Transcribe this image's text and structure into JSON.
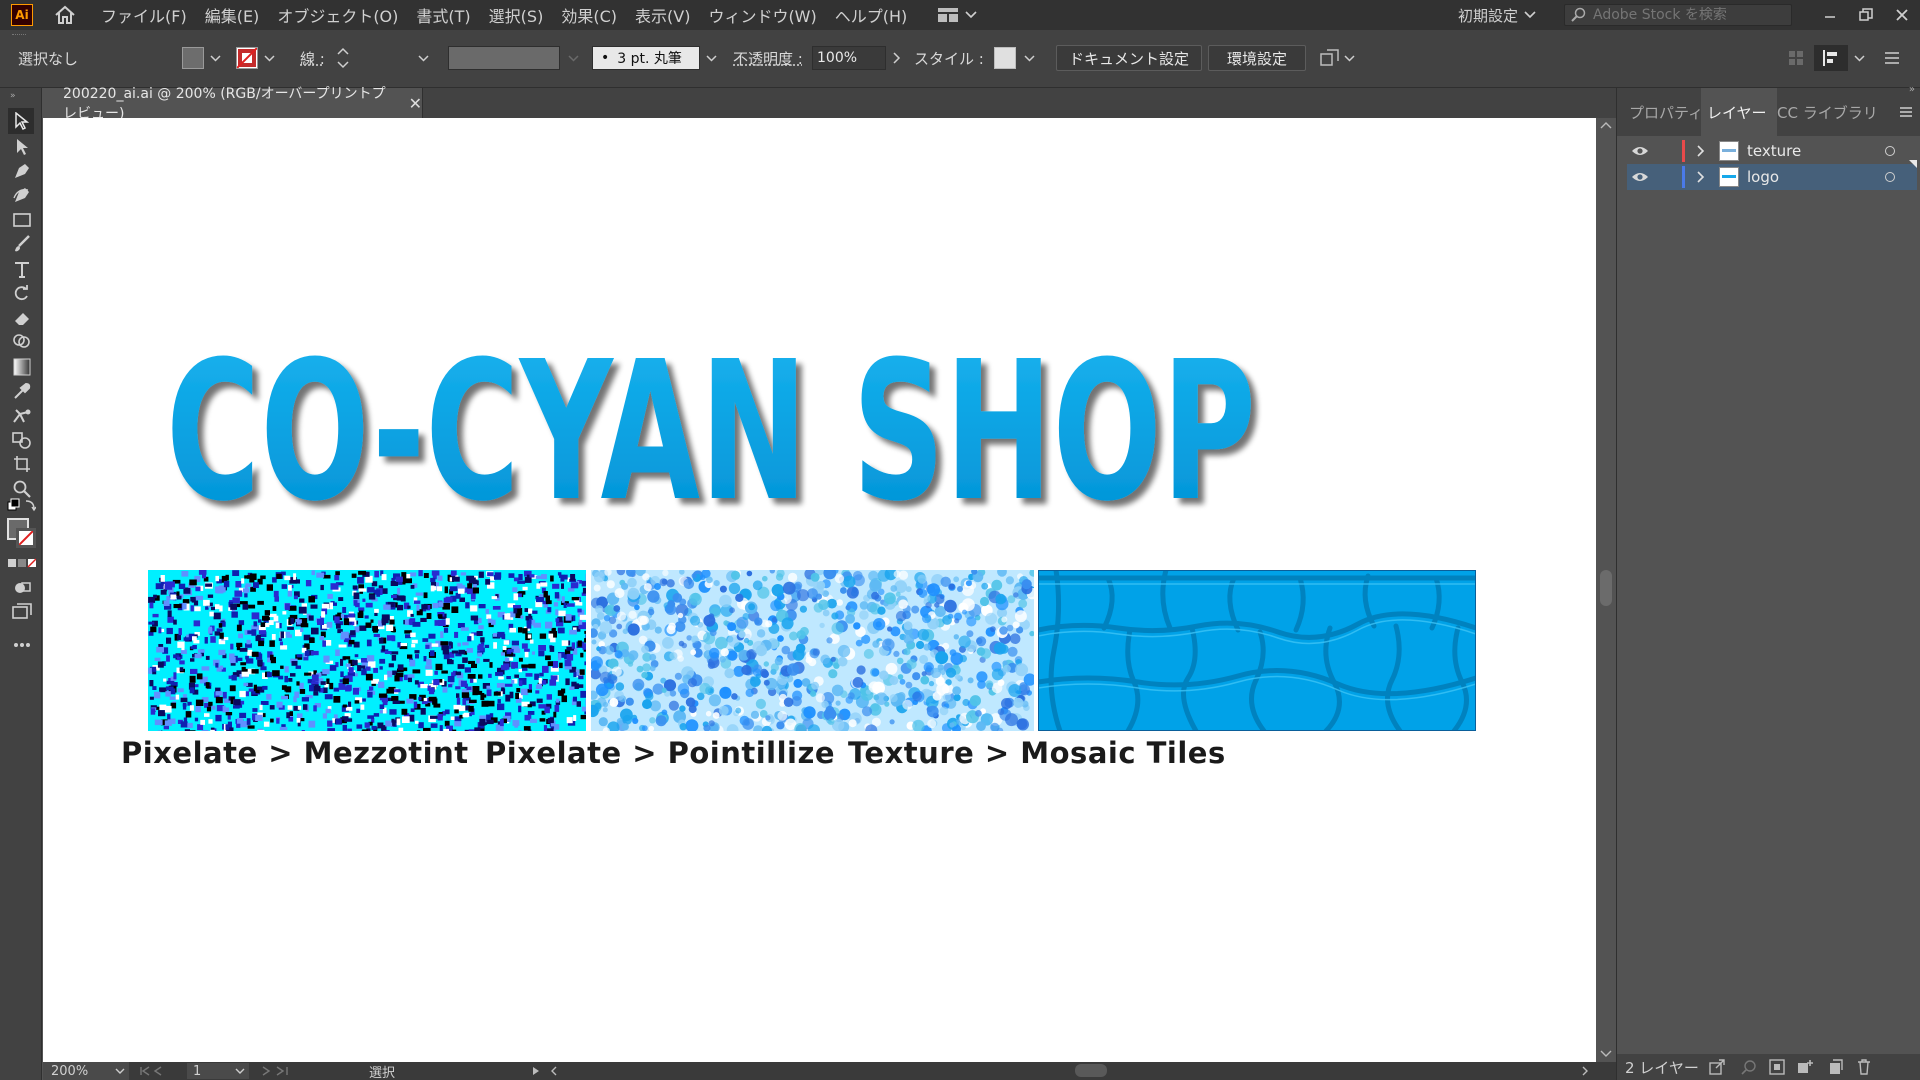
{
  "menubar": {
    "app_icon_text": "Ai",
    "items": [
      "ファイル(F)",
      "編集(E)",
      "オブジェクト(O)",
      "書式(T)",
      "選択(S)",
      "効果(C)",
      "表示(V)",
      "ウィンドウ(W)",
      "ヘルプ(H)"
    ],
    "preset": "初期設定",
    "stock_placeholder": "Adobe Stock を検索"
  },
  "controlbar": {
    "selection": "選択なし",
    "stroke_label": "線 :",
    "brush": "3 pt. 丸筆",
    "opacity_label": "不透明度 :",
    "opacity_value": "100%",
    "style_label": "スタイル :",
    "doc_settings": "ドキュメント設定",
    "preferences": "環境設定"
  },
  "document": {
    "tab_title": "200220_ai.ai @ 200% (RGB/オーバープリントプレビュー)",
    "logo_text": "CO-CYAN SHOP",
    "logo_color": "#00a0e0",
    "textures": [
      {
        "label": "Pixelate > Mezzotint"
      },
      {
        "label": "Pixelate > Pointillize"
      },
      {
        "label": "Texture > Mosaic Tiles"
      }
    ]
  },
  "statusbar": {
    "zoom": "200%",
    "page": "1",
    "tool": "選択"
  },
  "layers_panel": {
    "tabs": [
      "プロパティ",
      "レイヤー",
      "CC ライブラリ"
    ],
    "layers": [
      {
        "name": "texture",
        "color": "#e84a4a",
        "selected": false
      },
      {
        "name": "logo",
        "color": "#4a7ae8",
        "selected": true
      }
    ],
    "footer": "2 レイヤー"
  }
}
